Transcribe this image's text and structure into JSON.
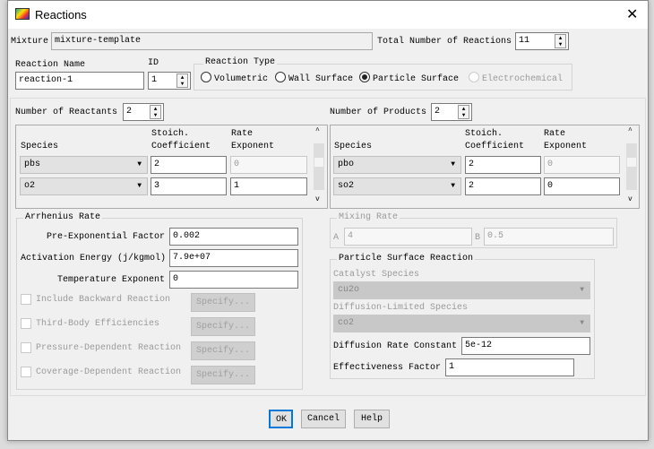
{
  "window": {
    "title": "Reactions",
    "close": "✕"
  },
  "mixture": {
    "label": "Mixture",
    "value": "mixture-template"
  },
  "total_reactions": {
    "label": "Total Number of Reactions",
    "value": "11"
  },
  "reaction_name": {
    "label": "Reaction Name",
    "value": "reaction-1"
  },
  "id": {
    "label": "ID",
    "value": "1"
  },
  "reaction_type": {
    "label": "Reaction Type",
    "options": [
      "Volumetric",
      "Wall Surface",
      "Particle Surface",
      "Electrochemical"
    ],
    "selected": "Particle Surface"
  },
  "reactants": {
    "label": "Number of Reactants",
    "count": "2",
    "headers": {
      "species": "Species",
      "stoich1": "Stoich.",
      "stoich2": "Coefficient",
      "rate1": "Rate",
      "rate2": "Exponent"
    },
    "rows": [
      {
        "species": "pbs",
        "stoich": "2",
        "rate": "0"
      },
      {
        "species": "o2",
        "stoich": "3",
        "rate": "1"
      }
    ]
  },
  "products": {
    "label": "Number of Products",
    "count": "2",
    "headers": {
      "species": "Species",
      "stoich1": "Stoich.",
      "stoich2": "Coefficient",
      "rate1": "Rate",
      "rate2": "Exponent"
    },
    "rows": [
      {
        "species": "pbo",
        "stoich": "2",
        "rate": "0"
      },
      {
        "species": "so2",
        "stoich": "2",
        "rate": "0"
      }
    ]
  },
  "arrhenius": {
    "title": "Arrhenius Rate",
    "pre_exp_label": "Pre-Exponential Factor",
    "pre_exp": "0.002",
    "act_label": "Activation Energy (j/kgmol)",
    "act": "7.9e+07",
    "temp_label": "Temperature Exponent",
    "temp": "0",
    "options": [
      {
        "label": "Include Backward Reaction",
        "button": "Specify..."
      },
      {
        "label": "Third-Body Efficiencies",
        "button": "Specify..."
      },
      {
        "label": "Pressure-Dependent Reaction",
        "button": "Specify..."
      },
      {
        "label": "Coverage-Dependent Reaction",
        "button": "Specify..."
      }
    ]
  },
  "mixing": {
    "title": "Mixing Rate",
    "a_label": "A",
    "a": "4",
    "b_label": "B",
    "b": "0.5"
  },
  "particle": {
    "title": "Particle Surface Reaction",
    "catalyst_label": "Catalyst Species",
    "catalyst": "cu2o",
    "diff_species_label": "Diffusion-Limited Species",
    "diff_species": "co2",
    "diff_rate_label": "Diffusion Rate Constant",
    "diff_rate": "5e-12",
    "eff_label": "Effectiveness Factor",
    "eff": "1"
  },
  "buttons": {
    "ok": "OK",
    "cancel": "Cancel",
    "help": "Help"
  }
}
